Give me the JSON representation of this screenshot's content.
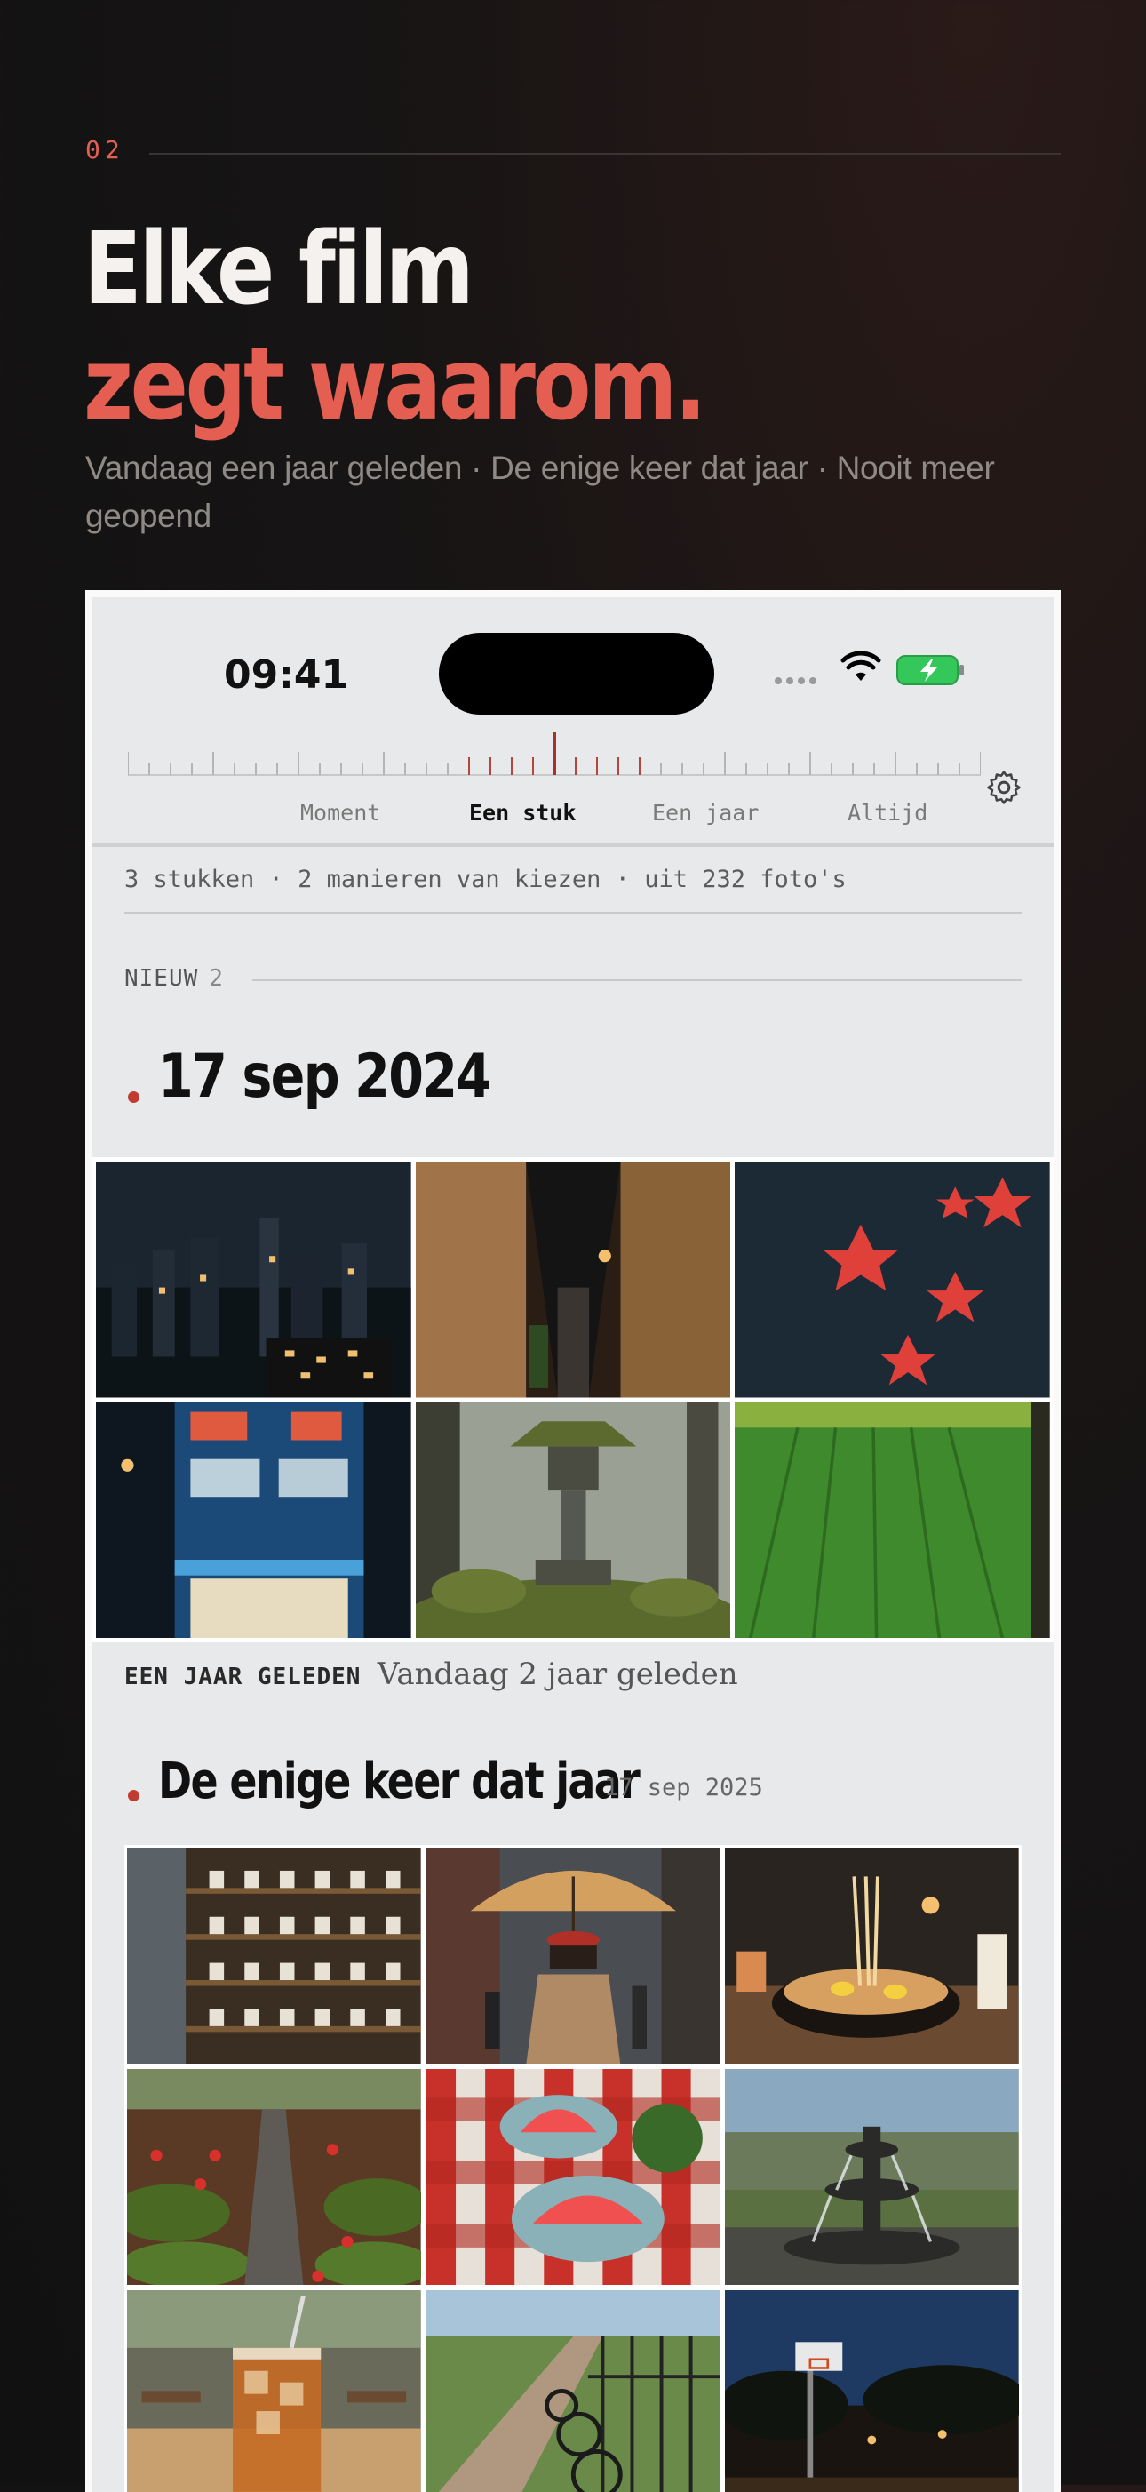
{
  "hero": {
    "number": "02",
    "title_line1": "Elke film",
    "title_line2": "zegt waarom.",
    "subtitle": "Vandaag een jaar geleden · De enige keer dat jaar · Nooit meer geopend"
  },
  "status_bar": {
    "time": "09:41"
  },
  "tabs": [
    {
      "label": "Moment",
      "active": false
    },
    {
      "label": "Een stuk",
      "active": true
    },
    {
      "label": "Een jaar",
      "active": false
    },
    {
      "label": "Altijd",
      "active": false
    }
  ],
  "summary": "3 stukken · 2 manieren van kiezen · uit 232 foto's",
  "new_section": {
    "label": "NIEUW",
    "count": "2"
  },
  "film1": {
    "date": "17 sep 2024",
    "photos": [
      "city-skyline-night",
      "narrow-alley",
      "red-maple-leaves",
      "corner-store-night",
      "stone-lantern-moss",
      "green-rice-field"
    ],
    "reason_label": "EEN JAAR GELEDEN",
    "reason_text": "Vandaag 2 jaar geleden"
  },
  "film2": {
    "title": "De enige keer dat jaar",
    "date": "17 sep 2025",
    "photos": [
      "ceramic-cups-shelf",
      "umbrella-street",
      "ramen-bowl",
      "moss-stone-path",
      "watermelon-picnic",
      "park-fountain",
      "iced-tea-cafe",
      "bikes-by-fence",
      "basketball-court-dusk"
    ]
  },
  "colors": {
    "accent": "#e45f51",
    "dot": "#c23b32",
    "battery": "#34c759"
  }
}
